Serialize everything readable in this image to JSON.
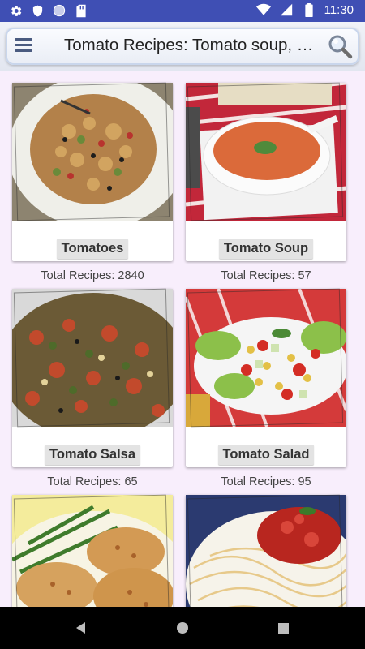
{
  "status_bar": {
    "time": "11:30",
    "icons": [
      "settings-icon",
      "shield-icon",
      "circle-icon",
      "sd-card-icon",
      "wifi-icon",
      "signal-icon",
      "battery-icon"
    ]
  },
  "app_bar": {
    "title": "Tomato Recipes: Tomato soup, Salsa",
    "menu_icon": "hamburger-menu-icon",
    "search_icon": "search-icon"
  },
  "cards": [
    {
      "name": "Tomatoes",
      "count": "Total Recipes: 2840",
      "image": "pasta-salad-photo"
    },
    {
      "name": "Tomato Soup",
      "count": "Total Recipes: 57",
      "image": "tomato-soup-photo"
    },
    {
      "name": "Tomato Salsa",
      "count": "Total Recipes: 65",
      "image": "tomato-salsa-photo"
    },
    {
      "name": "Tomato Salad",
      "count": "Total Recipes: 95",
      "image": "tomato-salad-photo"
    },
    {
      "name": "",
      "count": "",
      "image": "tomato-cutlets-photo"
    },
    {
      "name": "",
      "count": "",
      "image": "spaghetti-tomato-sauce-photo"
    }
  ],
  "nav_bar": {
    "back_icon": "back-icon",
    "home_icon": "home-icon",
    "recents_icon": "recents-icon"
  },
  "colors": {
    "status_bar": "#3f4fb4",
    "background": "#f8eefc",
    "label_bg": "#e3e3e3"
  }
}
